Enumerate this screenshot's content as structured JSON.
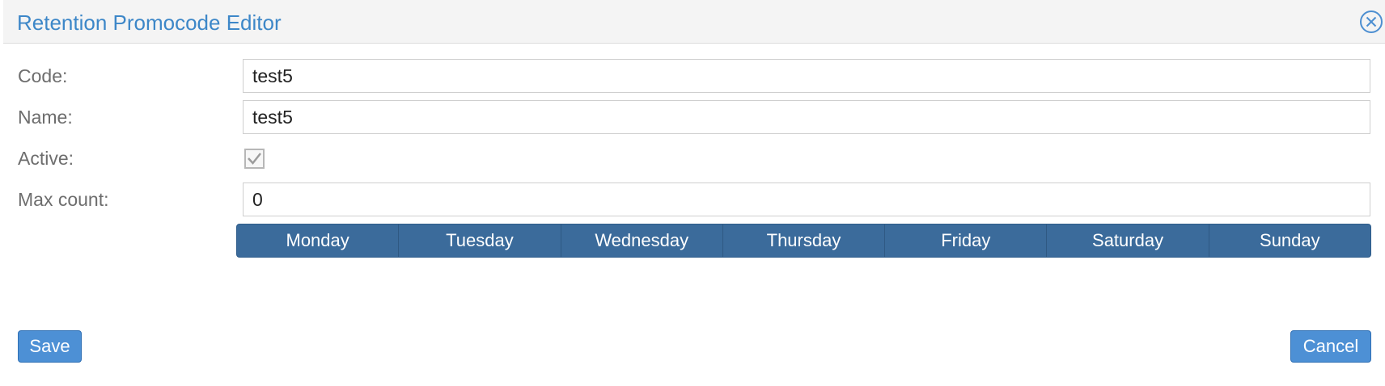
{
  "dialog": {
    "title": "Retention Promocode Editor"
  },
  "form": {
    "code_label": "Code:",
    "code_value": "test5",
    "name_label": "Name:",
    "name_value": "test5",
    "active_label": "Active:",
    "active_checked": true,
    "max_count_label": "Max count:",
    "max_count_value": "0"
  },
  "days": [
    "Monday",
    "Tuesday",
    "Wednesday",
    "Thursday",
    "Friday",
    "Saturday",
    "Sunday"
  ],
  "actions": {
    "save_label": "Save",
    "cancel_label": "Cancel"
  },
  "icons": {
    "close": "close-icon",
    "check": "check-icon"
  },
  "colors": {
    "title": "#3d87c8",
    "days_bar": "#3b6b9b",
    "button": "#4d90d5"
  }
}
